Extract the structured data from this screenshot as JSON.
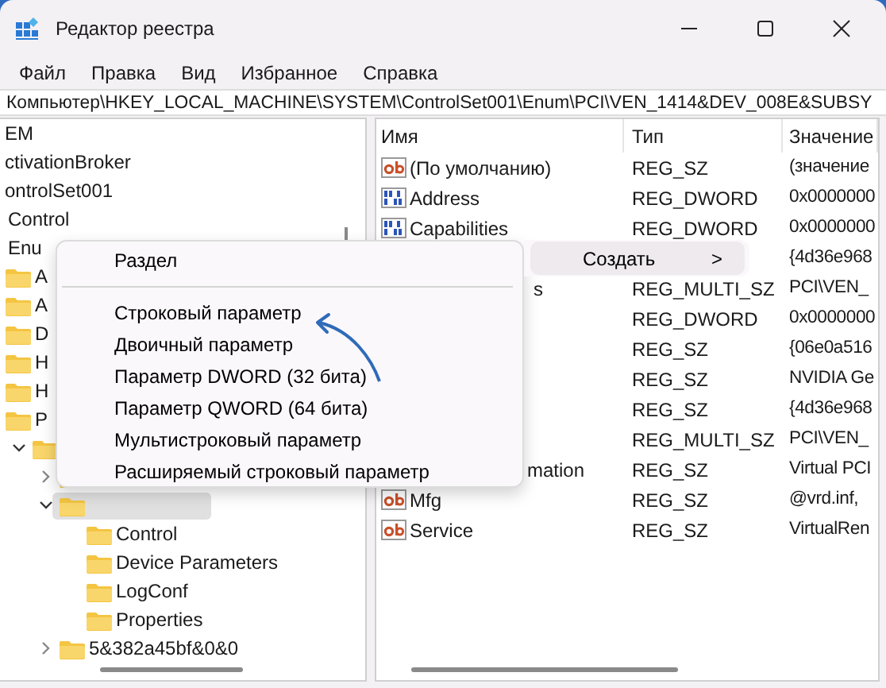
{
  "window": {
    "title": "Редактор реестра"
  },
  "menu_bar": [
    "Файл",
    "Правка",
    "Вид",
    "Избранное",
    "Справка"
  ],
  "address_bar": "Компьютер\\HKEY_LOCAL_MACHINE\\SYSTEM\\ControlSet001\\Enum\\PCI\\VEN_1414&DEV_008E&SUBSY",
  "tree": [
    {
      "label": "EM"
    },
    {
      "label": "ctivationBroker"
    },
    {
      "label": "ontrolSet001",
      "children": [
        {
          "label": "Control"
        },
        {
          "label": "Enu",
          "children": [
            {
              "label": "A"
            },
            {
              "label": "A"
            },
            {
              "label": "D"
            },
            {
              "label": "H"
            },
            {
              "label": "H"
            },
            {
              "label": "P",
              "children": [
                {
                  "expanded": true,
                  "children": [
                    {
                      "expanded": false
                    },
                    {
                      "expanded": true,
                      "selected": true,
                      "children": [
                        {
                          "label": "Control"
                        },
                        {
                          "label": "Device Parameters"
                        },
                        {
                          "label": "LogConf"
                        },
                        {
                          "label": "Properties"
                        }
                      ]
                    },
                    {
                      "label": "5&382a45bf&0&0",
                      "expanded": false
                    }
                  ]
                }
              ]
            }
          ]
        }
      ]
    }
  ],
  "table": {
    "columns": [
      "Имя",
      "Тип",
      "Значение"
    ],
    "rows": [
      {
        "kind": "string",
        "name": "(По умолчанию)",
        "type": "REG_SZ",
        "value": "(значение"
      },
      {
        "kind": "binary",
        "name": "Address",
        "type": "REG_DWORD",
        "value": "0x0000000"
      },
      {
        "kind": "binary",
        "name": "Capabilities",
        "type": "REG_DWORD",
        "value": "0x0000000"
      },
      {
        "kind": "covered",
        "value": "{4d36e968"
      },
      {
        "kind": "covered",
        "name": "s",
        "type": "REG_MULTI_SZ",
        "value": "PCI\\VEN_"
      },
      {
        "kind": "covered",
        "type": "REG_DWORD",
        "value": "0x0000000"
      },
      {
        "kind": "covered",
        "type": "REG_SZ",
        "value": "{06e0a516"
      },
      {
        "kind": "covered",
        "type": "REG_SZ",
        "value": "NVIDIA Ge"
      },
      {
        "kind": "covered",
        "type": "REG_SZ",
        "value": "{4d36e968"
      },
      {
        "kind": "covered",
        "type": "REG_MULTI_SZ",
        "value": "PCI\\VEN_"
      },
      {
        "kind": "covered",
        "name": "mation",
        "type": "REG_SZ",
        "value": "Virtual PCI"
      },
      {
        "kind": "string",
        "name": "Mfg",
        "type": "REG_SZ",
        "value": "@vrd.inf,"
      },
      {
        "kind": "string",
        "name": "Service",
        "type": "REG_SZ",
        "value": "VirtualRen"
      }
    ]
  },
  "context_menu": {
    "items": [
      {
        "label": "Раздел",
        "kind": "item"
      },
      {
        "kind": "divider"
      },
      {
        "label": "Строковый параметр",
        "kind": "item"
      },
      {
        "label": "Двоичный параметр",
        "kind": "item"
      },
      {
        "label": "Параметр DWORD (32 бита)",
        "kind": "item"
      },
      {
        "label": "Параметр QWORD (64 бита)",
        "kind": "item"
      },
      {
        "label": "Мультистроковый параметр",
        "kind": "item"
      },
      {
        "label": "Расширяемый строковый параметр",
        "kind": "item"
      }
    ]
  },
  "parent_menu": {
    "label": "Создать",
    "arrow": ">",
    "highlighted": true
  }
}
